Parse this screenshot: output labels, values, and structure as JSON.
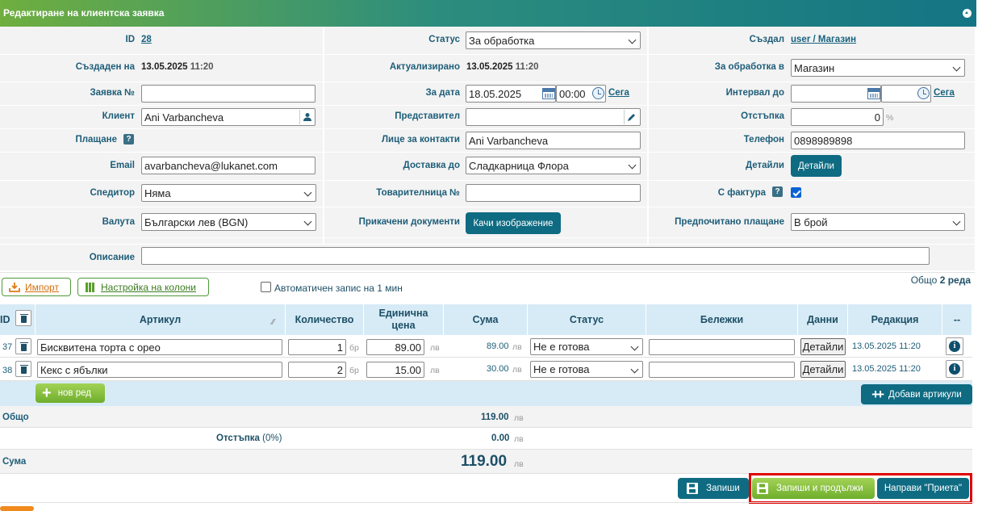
{
  "title": "Редактиране на клиентска заявка",
  "form": {
    "id_label": "ID",
    "id_value": "28",
    "status_label": "Статус",
    "status_value": "За обработка",
    "created_by_label": "Създал",
    "created_by_value": "user / Магазин",
    "created_label": "Създаден на",
    "created_date": "13.05.2025",
    "created_time": "11:20",
    "updated_label": "Актуализирано",
    "updated_date": "13.05.2025",
    "updated_time": "11:20",
    "process_in_label": "За обработка в",
    "process_in_value": "Магазин",
    "order_no_label": "Заявка №",
    "order_no_value": "",
    "for_date_label": "За дата",
    "for_date_value": "18.05.2025",
    "for_time_value": "00:00",
    "now_link": "Сега",
    "interval_label": "Интервал до",
    "interval_date": "",
    "interval_time": "",
    "interval_now_link": "Сега",
    "client_label": "Клиент",
    "client_value": "Ani Varbancheva",
    "representative_label": "Представител",
    "representative_value": "",
    "discount_label": "Отстъпка",
    "discount_value": "0",
    "discount_unit": "%",
    "payment_label": "Плащане",
    "contact_label": "Лице за контакти",
    "contact_value": "Ani Varbancheva",
    "phone_label": "Телефон",
    "phone_value": "0898989898",
    "email_label": "Email",
    "email_value": "avarbancheva@lukanet.com",
    "delivery_label": "Доставка до",
    "delivery_value": "Сладкарница Флора",
    "details_label": "Детайли",
    "details_button": "Детайли",
    "forwarder_label": "Спедитор",
    "forwarder_value": "Няма",
    "waybill_label": "Товарителница №",
    "waybill_value": "",
    "invoice_label": "С фактура",
    "currency_label": "Валута",
    "currency_value": "Български лев (BGN)",
    "attachments_label": "Прикачени документи",
    "upload_button": "Качи изображение",
    "pref_payment_label": "Предпочитано плащане",
    "pref_payment_value": "В брой",
    "description_label": "Описание",
    "description_value": ""
  },
  "toolbar": {
    "import_label": "Импорт",
    "columns_label": "Настройка на колони",
    "autosave_label": "Автоматичен запис на 1 мин",
    "total_prefix": "Общо",
    "total_count": "2 реда"
  },
  "table": {
    "headers": {
      "id": "ID",
      "article": "Артикул",
      "qty": "Количество",
      "unit_price": "Единична цена",
      "sum": "Сума",
      "status": "Статус",
      "notes": "Бележки",
      "data": "Данни",
      "edit": "Редакция",
      "more": "--"
    },
    "rows": [
      {
        "id": "37",
        "article": "Бисквитена торта с орео",
        "qty": "1",
        "qty_unit": "бр",
        "price": "89.00",
        "price_unit": "лв",
        "sum": "89.00",
        "sum_unit": "лв",
        "status": "Не е готова",
        "notes": "",
        "data_button": "Детайли",
        "edited": "13.05.2025 11:20"
      },
      {
        "id": "38",
        "article": "Кекс с ябълки",
        "qty": "2",
        "qty_unit": "бр",
        "price": "15.00",
        "price_unit": "лв",
        "sum": "30.00",
        "sum_unit": "лв",
        "status": "Не е готова",
        "notes": "",
        "data_button": "Детайли",
        "edited": "13.05.2025 11:20"
      }
    ],
    "new_row_button": "нов ред",
    "add_articles_button": "Добави артикули"
  },
  "totals": {
    "total_label": "Общо",
    "total_value": "119.00",
    "total_unit": "лв",
    "discount_label": "Отстъпка",
    "discount_pct": "(0%)",
    "discount_value": "0.00",
    "discount_unit": "лв",
    "sum_label": "Сума",
    "sum_value": "119.00",
    "sum_unit": "лв"
  },
  "actions": {
    "save": "Запиши",
    "save_continue": "Запиши и продължи",
    "make_accepted": "Направи \"Приета\""
  },
  "colors": {
    "teal": "#0e6b82",
    "green": "#8cc63f",
    "highlight": "#e00000"
  }
}
